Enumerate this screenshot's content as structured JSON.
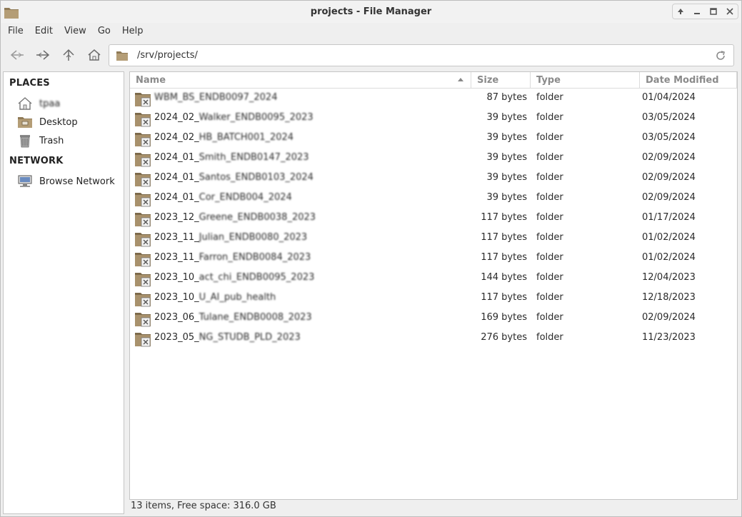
{
  "window": {
    "title": "projects - File Manager"
  },
  "menu": [
    "File",
    "Edit",
    "View",
    "Go",
    "Help"
  ],
  "toolbar": {
    "path": "/srv/projects/"
  },
  "sidebar": {
    "places_header": "PLACES",
    "places": [
      {
        "label": "tpaa",
        "icon": "home-icon"
      },
      {
        "label": "Desktop",
        "icon": "desktop-icon"
      },
      {
        "label": "Trash",
        "icon": "trash-icon"
      }
    ],
    "network_header": "NETWORK",
    "network": [
      {
        "label": "Browse Network",
        "icon": "network-icon"
      }
    ]
  },
  "columns": {
    "name": "Name",
    "size": "Size",
    "type": "Type",
    "date": "Date Modified"
  },
  "files": [
    {
      "prefix": "",
      "tail": "WBM_BS_ENDB0097_2024",
      "size": "87 bytes",
      "type": "folder",
      "date": "01/04/2024"
    },
    {
      "prefix": "2024_02_",
      "tail": "Walker_ENDB0095_2023",
      "size": "39 bytes",
      "type": "folder",
      "date": "03/05/2024"
    },
    {
      "prefix": "2024_02_",
      "tail": "HB_BATCH001_2024",
      "size": "39 bytes",
      "type": "folder",
      "date": "03/05/2024"
    },
    {
      "prefix": "2024_01_",
      "tail": "Smith_ENDB0147_2023",
      "size": "39 bytes",
      "type": "folder",
      "date": "02/09/2024"
    },
    {
      "prefix": "2024_01_",
      "tail": "Santos_ENDB0103_2024",
      "size": "39 bytes",
      "type": "folder",
      "date": "02/09/2024"
    },
    {
      "prefix": "2024_01_",
      "tail": "Cor_ENDB004_2024",
      "size": "39 bytes",
      "type": "folder",
      "date": "02/09/2024"
    },
    {
      "prefix": "2023_12_",
      "tail": "Greene_ENDB0038_2023",
      "size": "117 bytes",
      "type": "folder",
      "date": "01/17/2024"
    },
    {
      "prefix": "2023_11_",
      "tail": "Julian_ENDB0080_2023",
      "size": "117 bytes",
      "type": "folder",
      "date": "01/02/2024"
    },
    {
      "prefix": "2023_11_",
      "tail": "Farron_ENDB0084_2023",
      "size": "117 bytes",
      "type": "folder",
      "date": "01/02/2024"
    },
    {
      "prefix": "2023_10_",
      "tail": "act_chi_ENDB0095_2023",
      "size": "144 bytes",
      "type": "folder",
      "date": "12/04/2023"
    },
    {
      "prefix": "2023_10_",
      "tail": "U_AI_pub_health",
      "size": "117 bytes",
      "type": "folder",
      "date": "12/18/2023"
    },
    {
      "prefix": "2023_06_",
      "tail": "Tulane_ENDB0008_2023",
      "size": "169 bytes",
      "type": "folder",
      "date": "02/09/2024"
    },
    {
      "prefix": "2023_05_",
      "tail": "NG_STUDB_PLD_2023",
      "size": "276 bytes",
      "type": "folder",
      "date": "11/23/2023"
    }
  ],
  "status": "13 items, Free space: 316.0 GB",
  "colors": {
    "folder": "#a8916c",
    "folder_dark": "#7d6a4b",
    "accent": "#3a3a3a"
  }
}
